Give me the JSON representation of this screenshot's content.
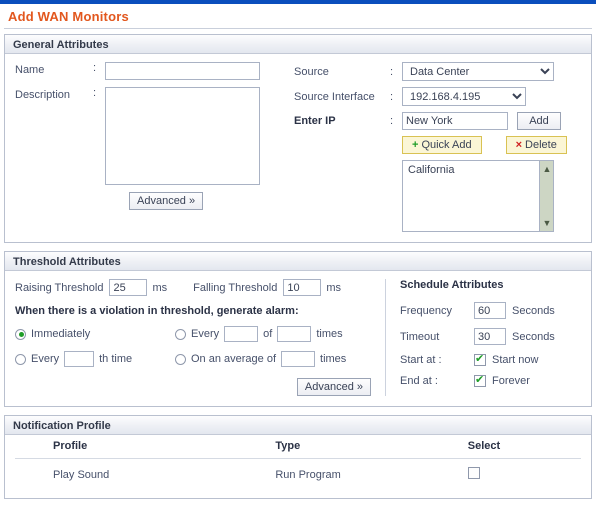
{
  "page": {
    "title": "Add WAN Monitors"
  },
  "general": {
    "section_title": "General Attributes",
    "name_label": "Name",
    "description_label": "Description",
    "colon": ":",
    "name_value": "",
    "description_value": "",
    "advanced_label": "Advanced »",
    "source_label": "Source",
    "source_value": "Data Center",
    "source_interface_label": "Source Interface",
    "source_interface_value": "192.168.4.195",
    "enter_ip_label": "Enter IP",
    "enter_ip_value": "New York",
    "add_label": "Add",
    "quick_add_label": "Quick Add",
    "quick_add_icon": "+",
    "delete_label": "Delete",
    "delete_icon": "×",
    "ip_list": [
      "California"
    ],
    "scroll_up_icon": "▲",
    "scroll_down_icon": "▼"
  },
  "threshold": {
    "section_title": "Threshold Attributes",
    "raising_label": "Raising Threshold",
    "raising_value": "25",
    "raising_unit": "ms",
    "falling_label": "Falling Threshold",
    "falling_value": "10",
    "falling_unit": "ms",
    "violation_text": "When there is a violation in threshold, generate alarm:",
    "opt_immediately": "Immediately",
    "opt_every_nth_pre": "Every",
    "opt_every_nth_post": "th time",
    "opt_every_nth_value": "",
    "opt_every_of_pre": "Every",
    "opt_every_of_mid": "of",
    "opt_every_of_post": "times",
    "opt_every_of_v1": "",
    "opt_every_of_v2": "",
    "opt_average_pre": "On an average of",
    "opt_average_post": "times",
    "opt_average_value": "",
    "selected_option": "Immediately",
    "advanced_label": "Advanced »"
  },
  "schedule": {
    "title": "Schedule Attributes",
    "frequency_label": "Frequency",
    "frequency_value": "60",
    "frequency_unit": "Seconds",
    "timeout_label": "Timeout",
    "timeout_value": "30",
    "timeout_unit": "Seconds",
    "start_label": "Start at :",
    "start_now_label": "Start now",
    "start_now_checked": true,
    "end_label": "End at :",
    "forever_label": "Forever",
    "forever_checked": true
  },
  "notification": {
    "section_title": "Notification Profile",
    "columns": [
      "Profile",
      "Type",
      "Select"
    ],
    "rows": [
      {
        "profile": "Play Sound",
        "type": "Run Program",
        "selected": false
      }
    ]
  },
  "colors": {
    "topbar": "#0a4ebd",
    "title": "#e2571e",
    "accent_green": "#1f9d28",
    "accent_red": "#cf2020",
    "button_yellow": "#fbf6d6"
  }
}
